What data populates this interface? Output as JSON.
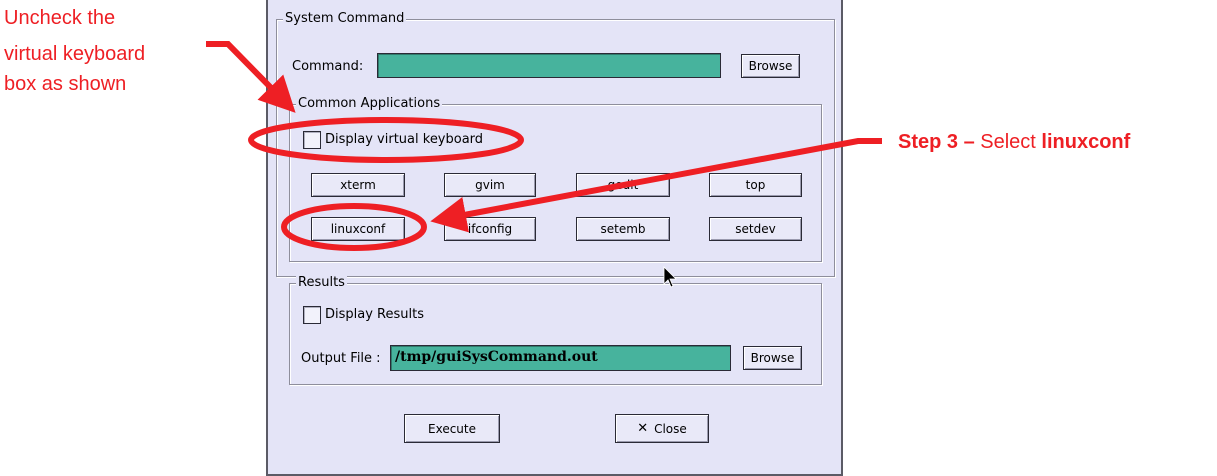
{
  "annotations": {
    "instruction_line1": "Uncheck the",
    "instruction_line2": "virtual keyboard",
    "instruction_line3": "box as shown",
    "step_label": "Step 3 –",
    "step_select": "Select",
    "step_target": "linuxconf",
    "color": "#ee1f24"
  },
  "system_command": {
    "legend": "System Command",
    "command_label": "Command:",
    "command_value": "",
    "browse_label": "Browse"
  },
  "common_applications": {
    "legend": "Common Applications",
    "virtual_keyboard_label": "Display virtual keyboard",
    "virtual_keyboard_checked": false,
    "buttons": [
      "xterm",
      "gvim",
      "gedit",
      "top",
      "linuxconf",
      "ifconfig",
      "setemb",
      "setdev"
    ]
  },
  "results": {
    "legend": "Results",
    "display_results_label": "Display Results",
    "display_results_checked": false,
    "output_file_label": "Output File :",
    "output_file_value": "/tmp/guiSysCommand.out",
    "browse_label": "Browse"
  },
  "actions": {
    "execute_label": "Execute",
    "close_label": "Close",
    "close_icon": "x-icon"
  },
  "colors": {
    "dialog_bg": "#e4e4f7",
    "field_bg": "#47b39d"
  }
}
